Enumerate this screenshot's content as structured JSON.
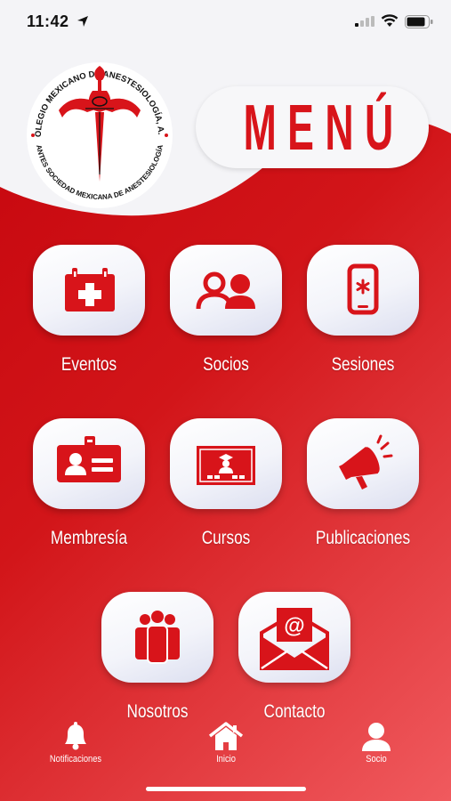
{
  "status_bar": {
    "time": "11:42"
  },
  "header": {
    "title": "MENÚ",
    "logo": {
      "ring_text_top": "COLEGIO MEXICANO DE ANESTESIOLOGÍA, A.C.",
      "ring_text_bottom": "ANTES SOCIEDAD MEXICANA DE ANESTESIOLOGÍA"
    }
  },
  "menu": {
    "items": [
      {
        "label": "Eventos",
        "icon": "calendar-medical-icon"
      },
      {
        "label": "Socios",
        "icon": "users-icon"
      },
      {
        "label": "Sesiones",
        "icon": "mobile-medical-icon"
      },
      {
        "label": "Membresía",
        "icon": "id-card-icon"
      },
      {
        "label": "Cursos",
        "icon": "chalkboard-teacher-icon"
      },
      {
        "label": "Publicaciones",
        "icon": "megaphone-icon"
      },
      {
        "label": "Nosotros",
        "icon": "group-icon"
      },
      {
        "label": "Contacto",
        "icon": "envelope-at-icon"
      }
    ]
  },
  "tabbar": {
    "items": [
      {
        "label": "Notificaciones",
        "icon": "bell-icon"
      },
      {
        "label": "Inicio",
        "icon": "home-icon"
      },
      {
        "label": "Socio",
        "icon": "user-icon"
      }
    ]
  },
  "colors": {
    "brand_red": "#d8141a",
    "tile_white": "#f7f7f9"
  }
}
